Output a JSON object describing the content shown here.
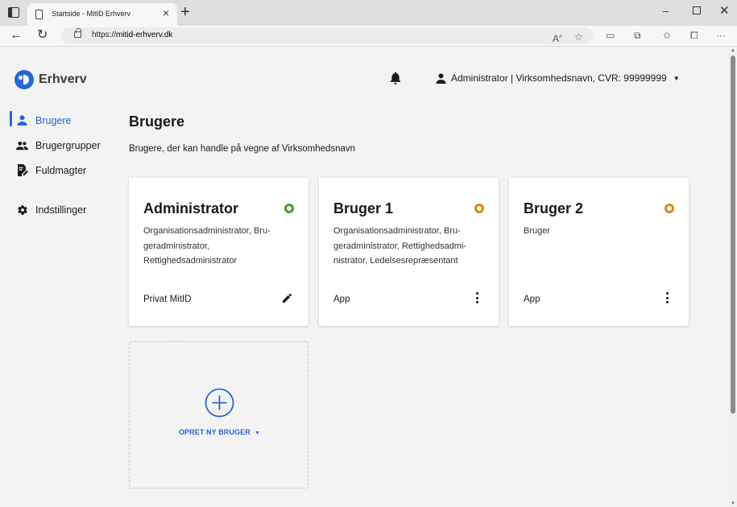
{
  "browser": {
    "tab_title": "Startside - MitID Erhverv",
    "url_prefix": "https://",
    "url_host": "mitid-erhverv.dk"
  },
  "header": {
    "logo_text": "Erhverv",
    "user_menu_label": "Administrator | Virksomhedsnavn, CVR: 99999999"
  },
  "sidebar": {
    "items": [
      {
        "label": "Brugere",
        "icon": "person-icon",
        "active": true
      },
      {
        "label": "Brugergrupper",
        "icon": "people-icon",
        "active": false
      },
      {
        "label": "Fuldmagter",
        "icon": "document-signature-icon",
        "active": false
      },
      {
        "label": "Indstillinger",
        "icon": "gear-icon",
        "active": false
      }
    ]
  },
  "main": {
    "title": "Brugere",
    "subtitle": "Brugere, der kan handle på vegne af Virksomhedsnavn",
    "cards": [
      {
        "name": "Administrator",
        "roles": "Organisationsadministrator, Bru-geradministrator, Rettighedsadministrator",
        "footer": "Privat MitID",
        "status": "active",
        "status_color": "#4b9b2c",
        "action": "edit-icon"
      },
      {
        "name": "Bruger 1",
        "roles": "Organisationsadministrator, Bru-geradministrator, Rettighedsadmi-nistrator, Ledelsesrepræsentant",
        "footer": "App",
        "status": "pending",
        "status_color": "#d98a19",
        "action": "more-vert-icon"
      },
      {
        "name": "Bruger 2",
        "roles": "Bruger",
        "footer": "App",
        "status": "pending",
        "status_color": "#d98a19",
        "action": "more-vert-icon"
      }
    ],
    "create_label": "OPRET NY BRUGER"
  },
  "colors": {
    "accent": "#2b64d4",
    "status_active": "#4b9b2c",
    "status_pending": "#d98a19"
  }
}
